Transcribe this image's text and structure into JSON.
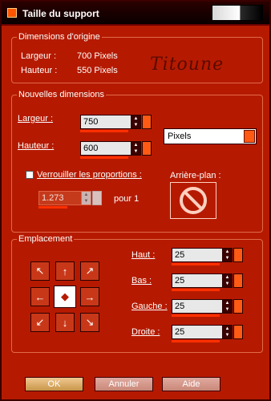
{
  "window": {
    "title": "Taille du support"
  },
  "original": {
    "group_label": "Dimensions d'origine",
    "width_label": "Largeur :",
    "width_value": "700 Pixels",
    "height_label": "Hauteur :",
    "height_value": "550 Pixels"
  },
  "logo_text": "Titoune",
  "new_dims": {
    "group_label": "Nouvelles dimensions",
    "width_label": "Largeur :",
    "width_value": "750",
    "height_label": "Hauteur :",
    "height_value": "600",
    "unit": "Pixels",
    "lock_label": "Verrouiller les proportions :",
    "ratio_value": "1.273",
    "ratio_suffix": "pour 1",
    "background_label": "Arrière-plan :"
  },
  "placement": {
    "group_label": "Emplacement",
    "top_label": "Haut :",
    "top_value": "25",
    "bottom_label": "Bas :",
    "bottom_value": "25",
    "left_label": "Gauche :",
    "left_value": "25",
    "right_label": "Droite :",
    "right_value": "25"
  },
  "buttons": {
    "ok": "OK",
    "cancel": "Annuler",
    "help": "Aide"
  }
}
